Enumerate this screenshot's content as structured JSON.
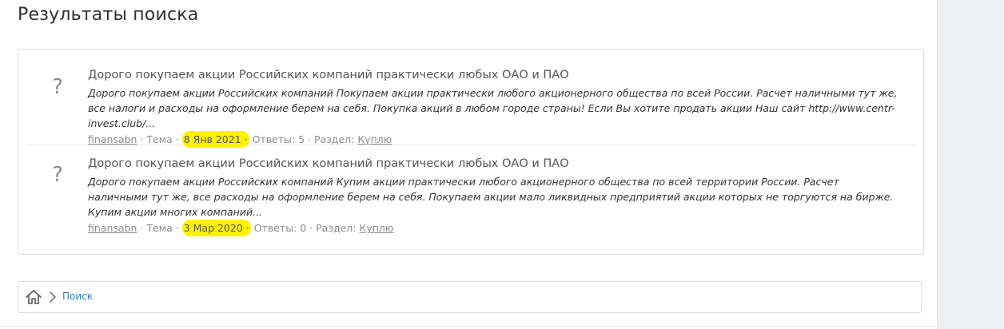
{
  "page": {
    "title": "Результаты поиска"
  },
  "results": [
    {
      "icon": "?",
      "title": "Дорого покупаем акции Российских компаний практически любых ОАО и ПАО",
      "snippet": "Дорого покупаем акции Российских компаний Покупаем акции практически любого акционерного общества по всей России. Расчет наличными тут же, все налоги и расходы на оформление берем на себя. Покупка акций в любом городе страны! Если Вы хотите продать акции Наш сайт http://www.centr-invest.club/...",
      "user": "finansabn",
      "type_label": "· Тема ·",
      "date": "8 Янв 2021 ·",
      "replies": "Ответы: 5 · Раздел:",
      "forum": "Куплю"
    },
    {
      "icon": "?",
      "title": "Дорого покупаем акции Российских компаний практически любых ОАО и ПАО",
      "snippet": "Дорого покупаем акции Российских компаний Купим акции практически любого акционерного общества по всей территории России. Расчет наличными тут же, все расходы на оформление берем на себя. Покупаем акции мало ликвидных предприятий акции которых не торгуются на бирже. Купим акции многих компаний...",
      "user": "finansabn",
      "type_label": "· Тема ·",
      "date": "3 Мар 2020 ·",
      "replies": "Ответы: 0 · Раздел:",
      "forum": "Куплю"
    }
  ],
  "breadcrumb": {
    "home_icon": "home-icon",
    "separator_icon": "chevron-right-icon",
    "current": "Поиск"
  },
  "colors": {
    "highlight": "#fff200",
    "link": "#2f7bbf"
  }
}
